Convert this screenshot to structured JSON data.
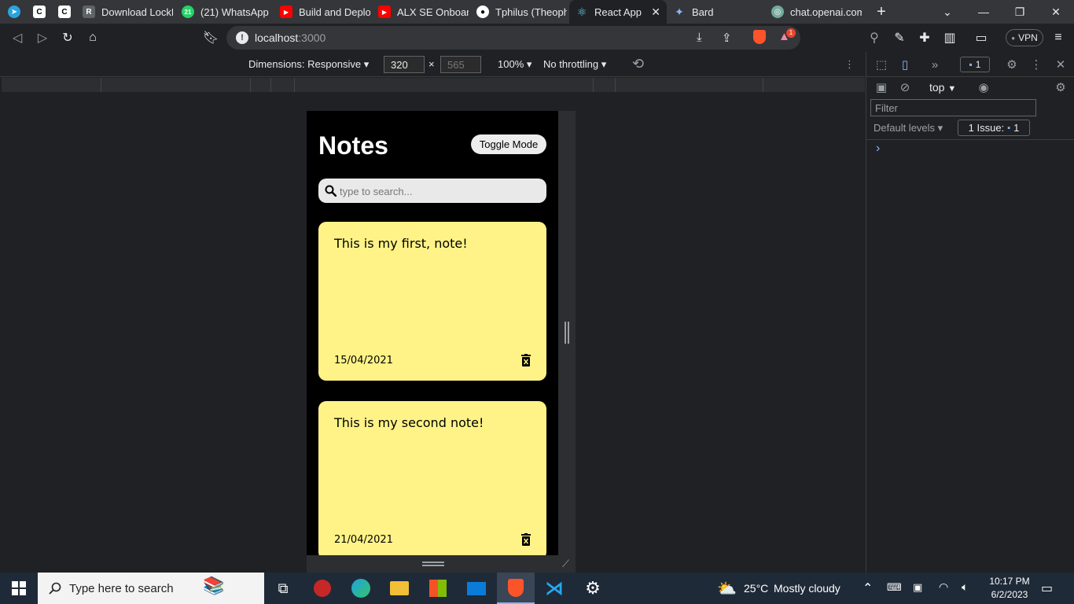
{
  "tabs": [
    {
      "label": "",
      "icon": "telegram-icon"
    },
    {
      "label": "",
      "icon": "c-app-icon"
    },
    {
      "label": "",
      "icon": "c-app-icon"
    },
    {
      "label": "Download LockD",
      "icon": "r-app-icon"
    },
    {
      "label": "(21) WhatsApp",
      "icon": "whatsapp-icon"
    },
    {
      "label": "Build and Deploy",
      "icon": "youtube-icon"
    },
    {
      "label": "ALX SE Onboard",
      "icon": "youtube-icon"
    },
    {
      "label": "Tphilus (Theophi",
      "icon": "github-icon"
    },
    {
      "label": "React App",
      "icon": "react-icon"
    },
    {
      "label": "Bard",
      "icon": "bard-icon"
    },
    {
      "label": "chat.openai.com",
      "icon": "openai-icon"
    }
  ],
  "browser": {
    "url_host": "localhost",
    "url_port": ":3000",
    "vpn_label": "VPN",
    "shield_badge": "1"
  },
  "device_toolbar": {
    "dimensions_label": "Dimensions: Responsive",
    "width": "320",
    "times": "×",
    "height": "565",
    "zoom": "100%",
    "throttling": "No throttling"
  },
  "app": {
    "title": "Notes",
    "toggle_label": "Toggle Mode",
    "search_placeholder": "type to search...",
    "notes": [
      {
        "text": "This is my first, note!",
        "date": "15/04/2021"
      },
      {
        "text": "This is my second note!",
        "date": "21/04/2021"
      }
    ],
    "note_color": "#fff387"
  },
  "devtools": {
    "issues_count": "1",
    "context": "top",
    "filter_placeholder": "Filter",
    "levels": "Default levels",
    "issue_label": "1 Issue:",
    "issue_count": "1",
    "prompt": "›"
  },
  "taskbar": {
    "search_text": "Type here to search",
    "weather_temp": "25°C",
    "weather_desc": "Mostly cloudy",
    "time": "10:17 PM",
    "date": "6/2/2023"
  }
}
